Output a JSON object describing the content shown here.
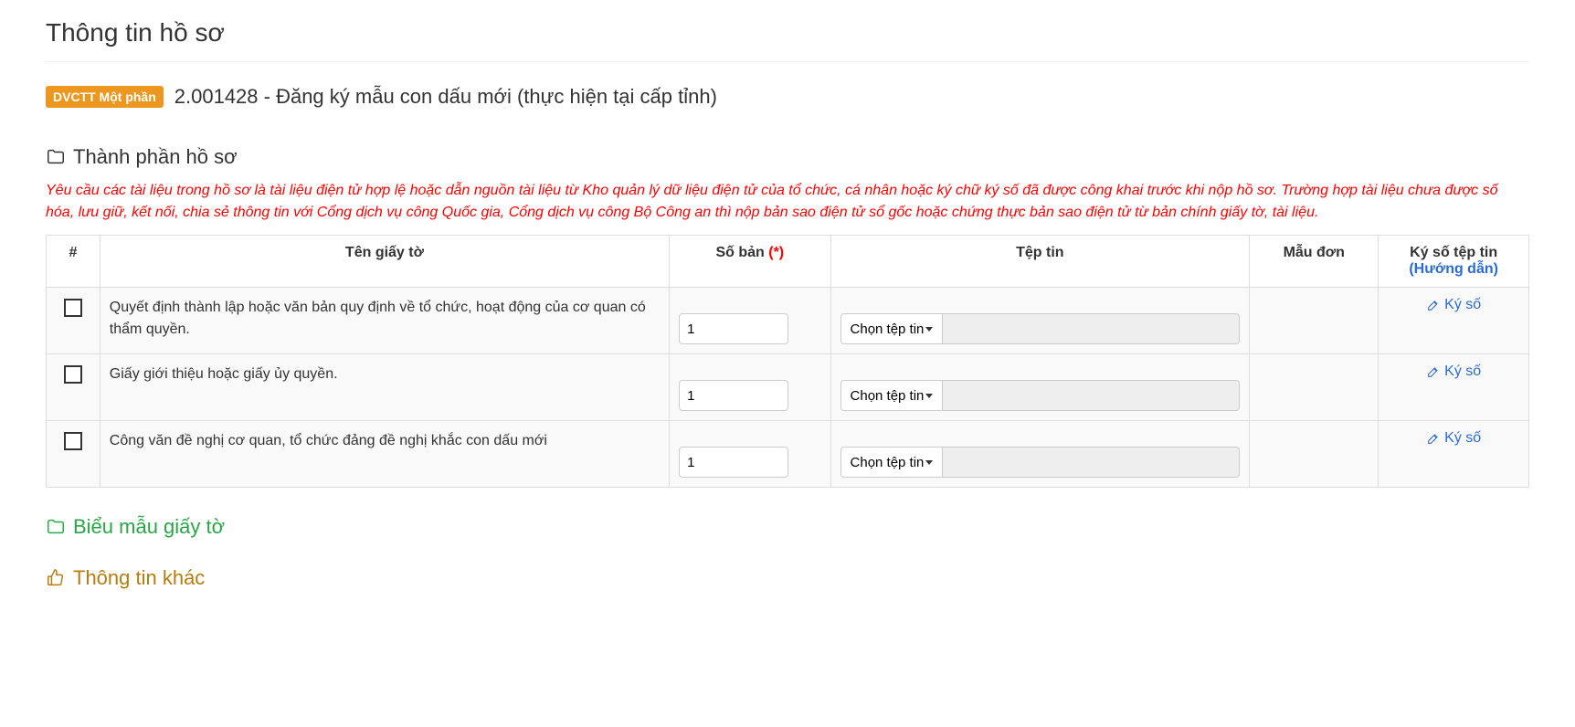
{
  "page_title": "Thông tin hồ sơ",
  "badge": "DVCTT Một phần",
  "service_title": "2.001428 - Đăng ký mẫu con dấu mới (thực hiện tại cấp tỉnh)",
  "section_components": "Thành phần hồ sơ",
  "warning_text": "Yêu cầu các tài liệu trong hồ sơ là tài liệu điện tử hợp lệ hoặc dẫn nguồn tài liệu từ Kho quản lý dữ liệu điện tử của tổ chức, cá nhân hoặc ký chữ ký số đã được công khai trước khi nộp hồ sơ. Trường hợp tài liệu chưa được số hóa, lưu giữ, kết nối, chia sẻ thông tin với Cổng dịch vụ công Quốc gia, Cổng dịch vụ công Bộ Công an thì nộp bản sao điện tử sổ gốc hoặc chứng thực bản sao điện tử từ bản chính giấy tờ, tài liệu.",
  "headers": {
    "col_check": "#",
    "col_name": "Tên giấy tờ",
    "col_qty_prefix": "Số bản ",
    "col_qty_star": "(*)",
    "col_file": "Tệp tin",
    "col_template": "Mẫu đơn",
    "col_sign": "Ký số tệp tin",
    "guide": "(Hướng dẫn)"
  },
  "file_button_label": "Chọn tệp tin",
  "sign_label": "Ký số",
  "rows": [
    {
      "name": "Quyết định thành lập hoặc văn bản quy định về tổ chức, hoạt động của cơ quan có thẩm quyền.",
      "qty": "1"
    },
    {
      "name": "Giấy giới thiệu hoặc giấy ủy quyền.",
      "qty": "1"
    },
    {
      "name": "Công văn đề nghị cơ quan, tổ chức đảng đề nghị khắc con dấu mới",
      "qty": "1"
    }
  ],
  "section_templates": "Biểu mẫu giấy tờ",
  "section_other": "Thông tin khác"
}
